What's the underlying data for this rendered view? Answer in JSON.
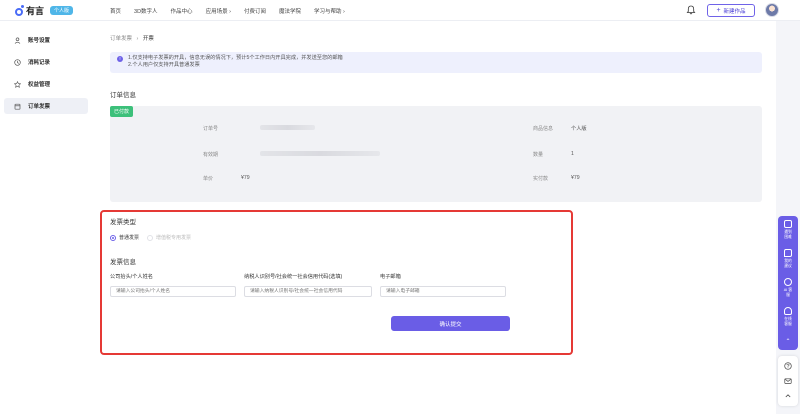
{
  "brand": {
    "name": "有言",
    "badge": "个人版"
  },
  "nav": [
    "首页",
    "3D数字人",
    "作品中心",
    "应用场景 ›",
    "付费订阅",
    "魔法学院",
    "学习与帮助 ›"
  ],
  "header": {
    "create_label": "新建作品",
    "create_icon": "plus-icon",
    "bell_icon": "bell-icon"
  },
  "sidebar": {
    "items": [
      {
        "label": "账号设置",
        "icon": "user-icon"
      },
      {
        "label": "消耗记录",
        "icon": "clock-icon"
      },
      {
        "label": "权益管理",
        "icon": "star-icon"
      },
      {
        "label": "订单发票",
        "icon": "receipt-icon",
        "active": true
      }
    ]
  },
  "breadcrumb": {
    "parent": "订单发票",
    "sep": "›",
    "current": "开票"
  },
  "notice": {
    "line1": "1.仅支持电子发票的开具，信息无误的情况下，预计5个工作日内开具完成，并发送至您的邮箱",
    "line2": "2.个人用户仅支持开具普通发票"
  },
  "order": {
    "title": "订单信息",
    "status": "已付款",
    "fields": {
      "order_no_label": "订单号",
      "valid_label": "有效期",
      "unit_price_label": "单价",
      "unit_price": "¥79",
      "product_label": "商品信息",
      "product": "个人版",
      "qty_label": "数量",
      "qty": "1",
      "paid_label": "实付款",
      "paid": "¥79"
    }
  },
  "invoice": {
    "type_title": "发票类型",
    "types": [
      {
        "label": "普通发票",
        "selected": true
      },
      {
        "label": "增值税专用发票",
        "selected": false
      }
    ],
    "info_title": "发票信息",
    "fields": [
      {
        "label": "公司抬头/个人姓名",
        "placeholder": "请输入公司抬头/个人姓名"
      },
      {
        "label": "纳税人识别号/社会统一社会信用代码(选填)",
        "placeholder": "请输入纳税人识别号/社会统一社会信用代码"
      },
      {
        "label": "电子邮箱",
        "placeholder": "请输入电子邮箱"
      }
    ],
    "submit_label": "确认提交"
  },
  "float_bar": {
    "items": [
      {
        "label": "遇到困难",
        "icon": "feedback-icon"
      },
      {
        "label": "我的建议",
        "icon": "chat-icon"
      },
      {
        "label": "AI 客服",
        "icon": "robot-icon"
      },
      {
        "label": "在线客服",
        "icon": "headset-icon"
      }
    ],
    "collapse_icon": "chevron-up-icon",
    "bottom": [
      "help-icon",
      "mail-icon",
      "back-to-top-icon"
    ]
  },
  "colors": {
    "accent": "#6a5de6",
    "paid": "#3cc07a",
    "highlight": "#e53935"
  }
}
